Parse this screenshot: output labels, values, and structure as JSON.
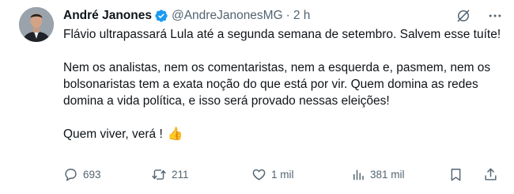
{
  "tweet": {
    "author_name": "André Janones",
    "handle": "@AndreJanonesMG",
    "separator": "·",
    "time": "2 h",
    "paragraphs": [
      "Flávio ultrapassará Lula até a segunda semana de setembro.  Salvem esse tuíte!",
      "Nem os analistas, nem os comentaristas, nem a esquerda e, pasmem, nem os bolsonaristas tem a exata noção do que está por vir. Quem domina as redes domina a vida política, e isso será provado nessas eleições!",
      "Quem viver, verá !"
    ],
    "emoji": "👍"
  },
  "actions": {
    "replies": "693",
    "retweets": "211",
    "likes": "1 mil",
    "views": "381 mil"
  },
  "icons": {
    "verified": "verified-badge-icon",
    "grok": "grok-icon",
    "more": "more-icon",
    "reply": "reply-icon",
    "retweet": "retweet-icon",
    "like": "heart-icon",
    "views": "views-icon",
    "bookmark": "bookmark-icon",
    "share": "share-icon"
  },
  "colors": {
    "text": "#0f1419",
    "secondary": "#536471",
    "verified": "#1d9bf0"
  }
}
